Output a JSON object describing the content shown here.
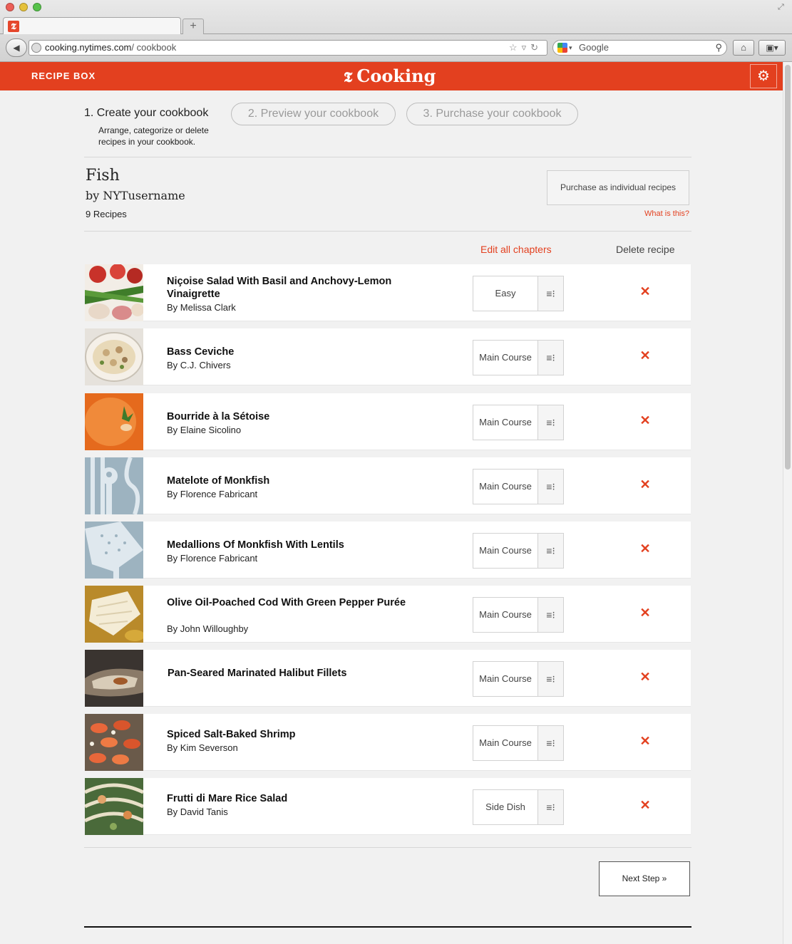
{
  "browser": {
    "favicon_glyph": "𝕿",
    "newtab_glyph": "+",
    "url_host": "cooking.nytimes.com",
    "url_path": "/ cookbook",
    "search_placeholder": "Google"
  },
  "header": {
    "recipe_box": "RECIPE BOX",
    "logo_glyph": "𝕿",
    "logo_text": "Cooking",
    "accent_color": "#e3401f"
  },
  "steps": {
    "step1": "1. Create your cookbook",
    "step1_sub": "Arrange, categorize or delete recipes in your cookbook.",
    "step2": "2. Preview your cookbook",
    "step3": "3. Purchase your cookbook"
  },
  "cookbook": {
    "title": "Fish",
    "author": "by NYTusername",
    "count": "9 Recipes",
    "purchase_label": "Purchase as individual recipes",
    "what_is_this": "What is this?"
  },
  "list_header": {
    "edit_chapters": "Edit all chapters",
    "delete_recipe": "Delete recipe"
  },
  "recipes": [
    {
      "title": "Niçoise Salad With Basil and Anchovy-Lemon Vinaigrette",
      "by": "By Melissa Clark",
      "chapter": "Easy"
    },
    {
      "title": "Bass Ceviche",
      "by": "By C.J. Chivers",
      "chapter": "Main Course"
    },
    {
      "title": "Bourride à la Sétoise",
      "by": "By Elaine Sicolino",
      "chapter": "Main Course"
    },
    {
      "title": "Matelote of Monkfish",
      "by": "By Florence Fabricant",
      "chapter": "Main Course"
    },
    {
      "title": "Medallions Of Monkfish With Lentils",
      "by": "By Florence Fabricant",
      "chapter": "Main Course"
    },
    {
      "title": "Olive Oil-Poached Cod With Green Pepper Purée",
      "by": "By John Willoughby",
      "chapter": "Main Course"
    },
    {
      "title": "Pan-Seared Marinated Halibut Fillets",
      "by": "",
      "chapter": "Main Course"
    },
    {
      "title": "Spiced Salt-Baked Shrimp",
      "by": "By Kim Severson",
      "chapter": "Main Course"
    },
    {
      "title": "Frutti di Mare Rice Salad",
      "by": "By David Tanis",
      "chapter": "Side Dish"
    }
  ],
  "icons": {
    "chapter_menu": "≡⁝",
    "delete": "✕",
    "gear": "⚙"
  },
  "footer": {
    "next_step": "Next Step »"
  }
}
